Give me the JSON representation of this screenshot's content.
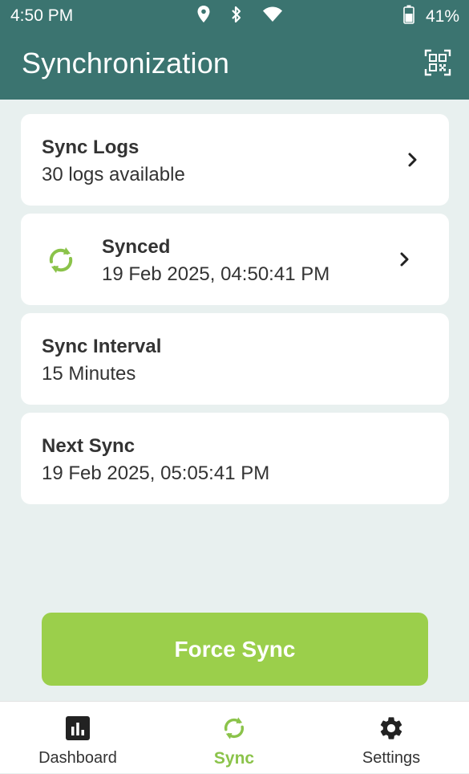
{
  "status_bar": {
    "time": "4:50 PM",
    "battery_percent": "41%",
    "icons": [
      "location-icon",
      "bluetooth-icon",
      "wifi-icon",
      "battery-icon"
    ]
  },
  "header": {
    "title": "Synchronization",
    "action_icon": "qr-code-icon"
  },
  "cards": {
    "sync_logs": {
      "title": "Sync Logs",
      "subtitle": "30 logs available"
    },
    "synced": {
      "title": "Synced",
      "subtitle": "19 Feb 2025, 04:50:41 PM",
      "icon": "sync-icon"
    },
    "interval": {
      "title": "Sync Interval",
      "subtitle": "15 Minutes"
    },
    "next_sync": {
      "title": "Next Sync",
      "subtitle": "19 Feb 2025, 05:05:41 PM"
    }
  },
  "force_sync": {
    "label": "Force Sync"
  },
  "bottom_nav": {
    "items": [
      {
        "label": "Dashboard",
        "icon": "bar-chart-icon",
        "active": false
      },
      {
        "label": "Sync",
        "icon": "sync-icon",
        "active": true
      },
      {
        "label": "Settings",
        "icon": "gear-icon",
        "active": false
      }
    ]
  },
  "colors": {
    "header": "#3b7470",
    "background": "#e8f0ef",
    "accent_green": "#9bcf4b",
    "text": "#333333"
  }
}
